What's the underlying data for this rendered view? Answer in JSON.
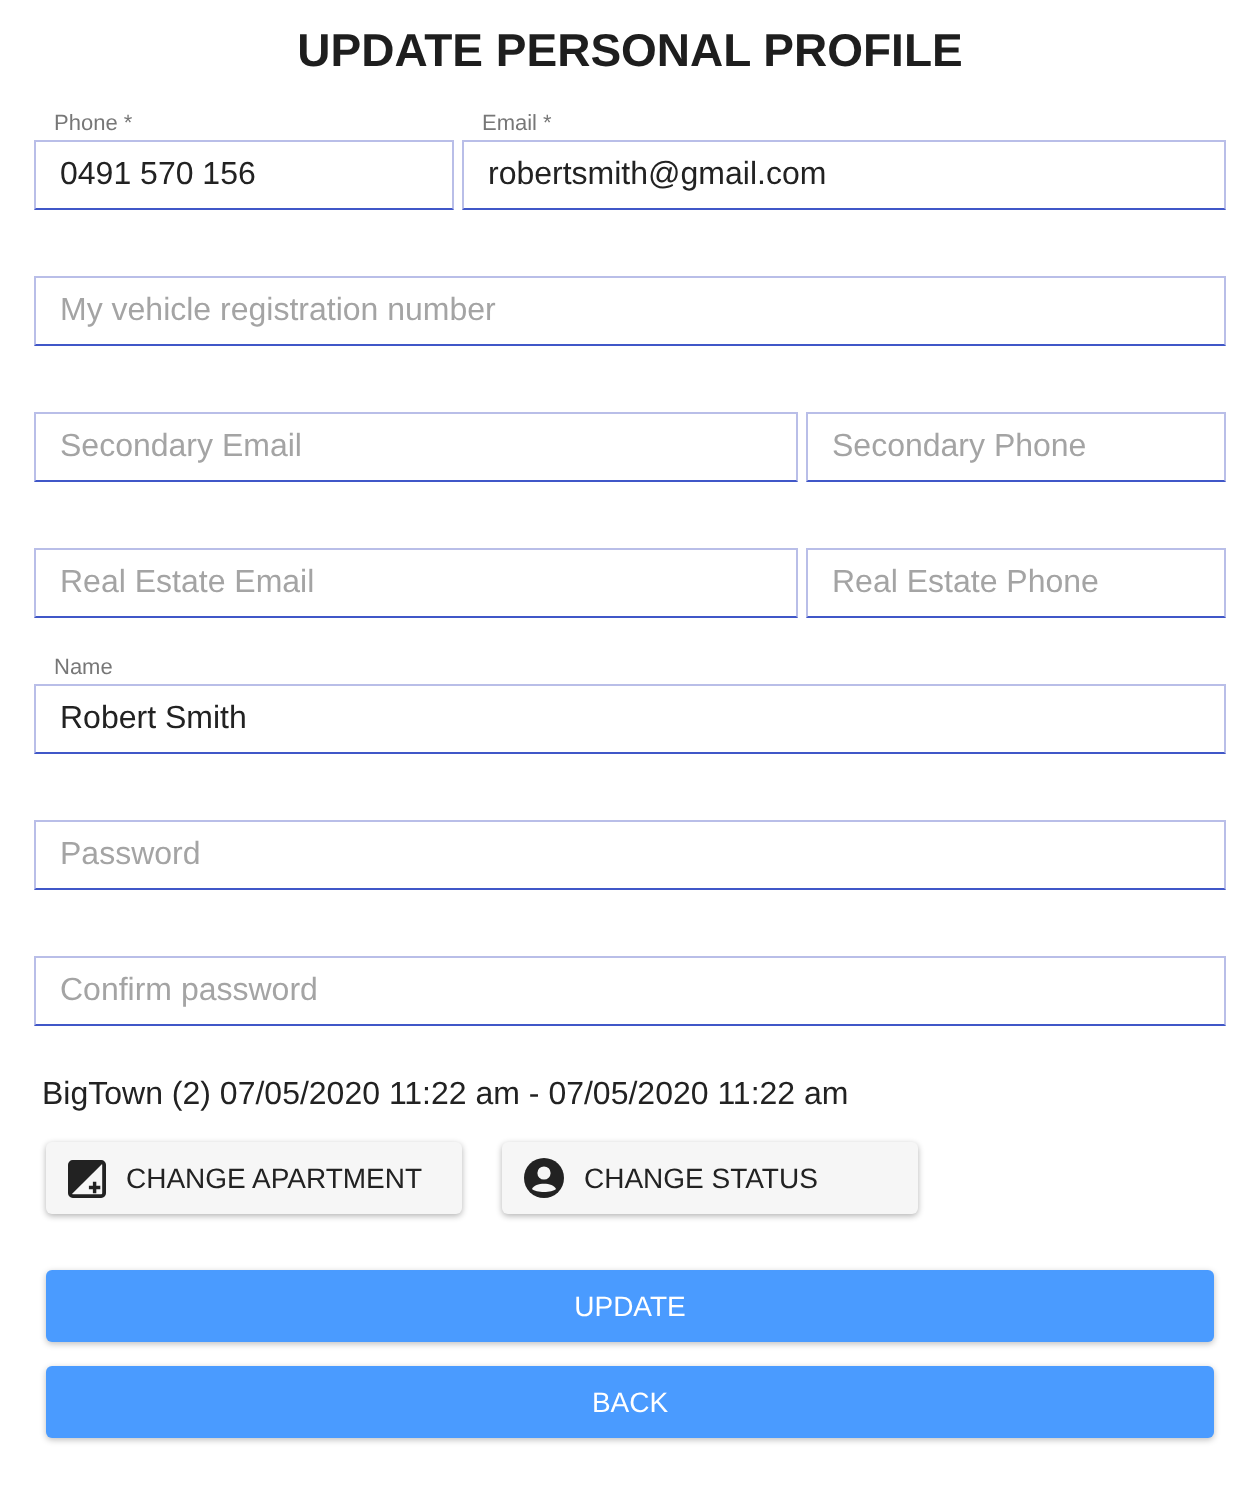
{
  "title": "UPDATE PERSONAL PROFILE",
  "rows": [
    {
      "fields": [
        {
          "kind": "phone",
          "label": "Phone *",
          "value": "0491 570 156"
        },
        {
          "kind": "email",
          "label": "Email *",
          "value": "robertsmith@gmail.com"
        }
      ]
    },
    {
      "fields": [
        {
          "kind": "text",
          "placeholder": "My vehicle registration number"
        }
      ]
    },
    {
      "fields": [
        {
          "kind": "email",
          "placeholder": "Secondary Email"
        },
        {
          "kind": "phone",
          "placeholder": "Secondary Phone"
        }
      ]
    },
    {
      "fields": [
        {
          "kind": "email",
          "placeholder": "Real Estate Email"
        },
        {
          "kind": "phone",
          "placeholder": "Real Estate Phone"
        }
      ]
    },
    {
      "fields": [
        {
          "kind": "text",
          "label": "Name",
          "value": "Robert Smith"
        }
      ]
    },
    {
      "fields": [
        {
          "kind": "password",
          "placeholder": "Password"
        }
      ]
    },
    {
      "fields": [
        {
          "kind": "password",
          "placeholder": "Confirm password"
        }
      ]
    }
  ],
  "stay": "BigTown (2) 07/05/2020 11:22 am - 07/05/2020 11:22 am",
  "actions": [
    {
      "kind": "apartment",
      "label": "CHANGE APARTMENT"
    },
    {
      "kind": "status",
      "label": "CHANGE STATUS"
    }
  ],
  "buttons": [
    "UPDATE",
    "BACK"
  ]
}
